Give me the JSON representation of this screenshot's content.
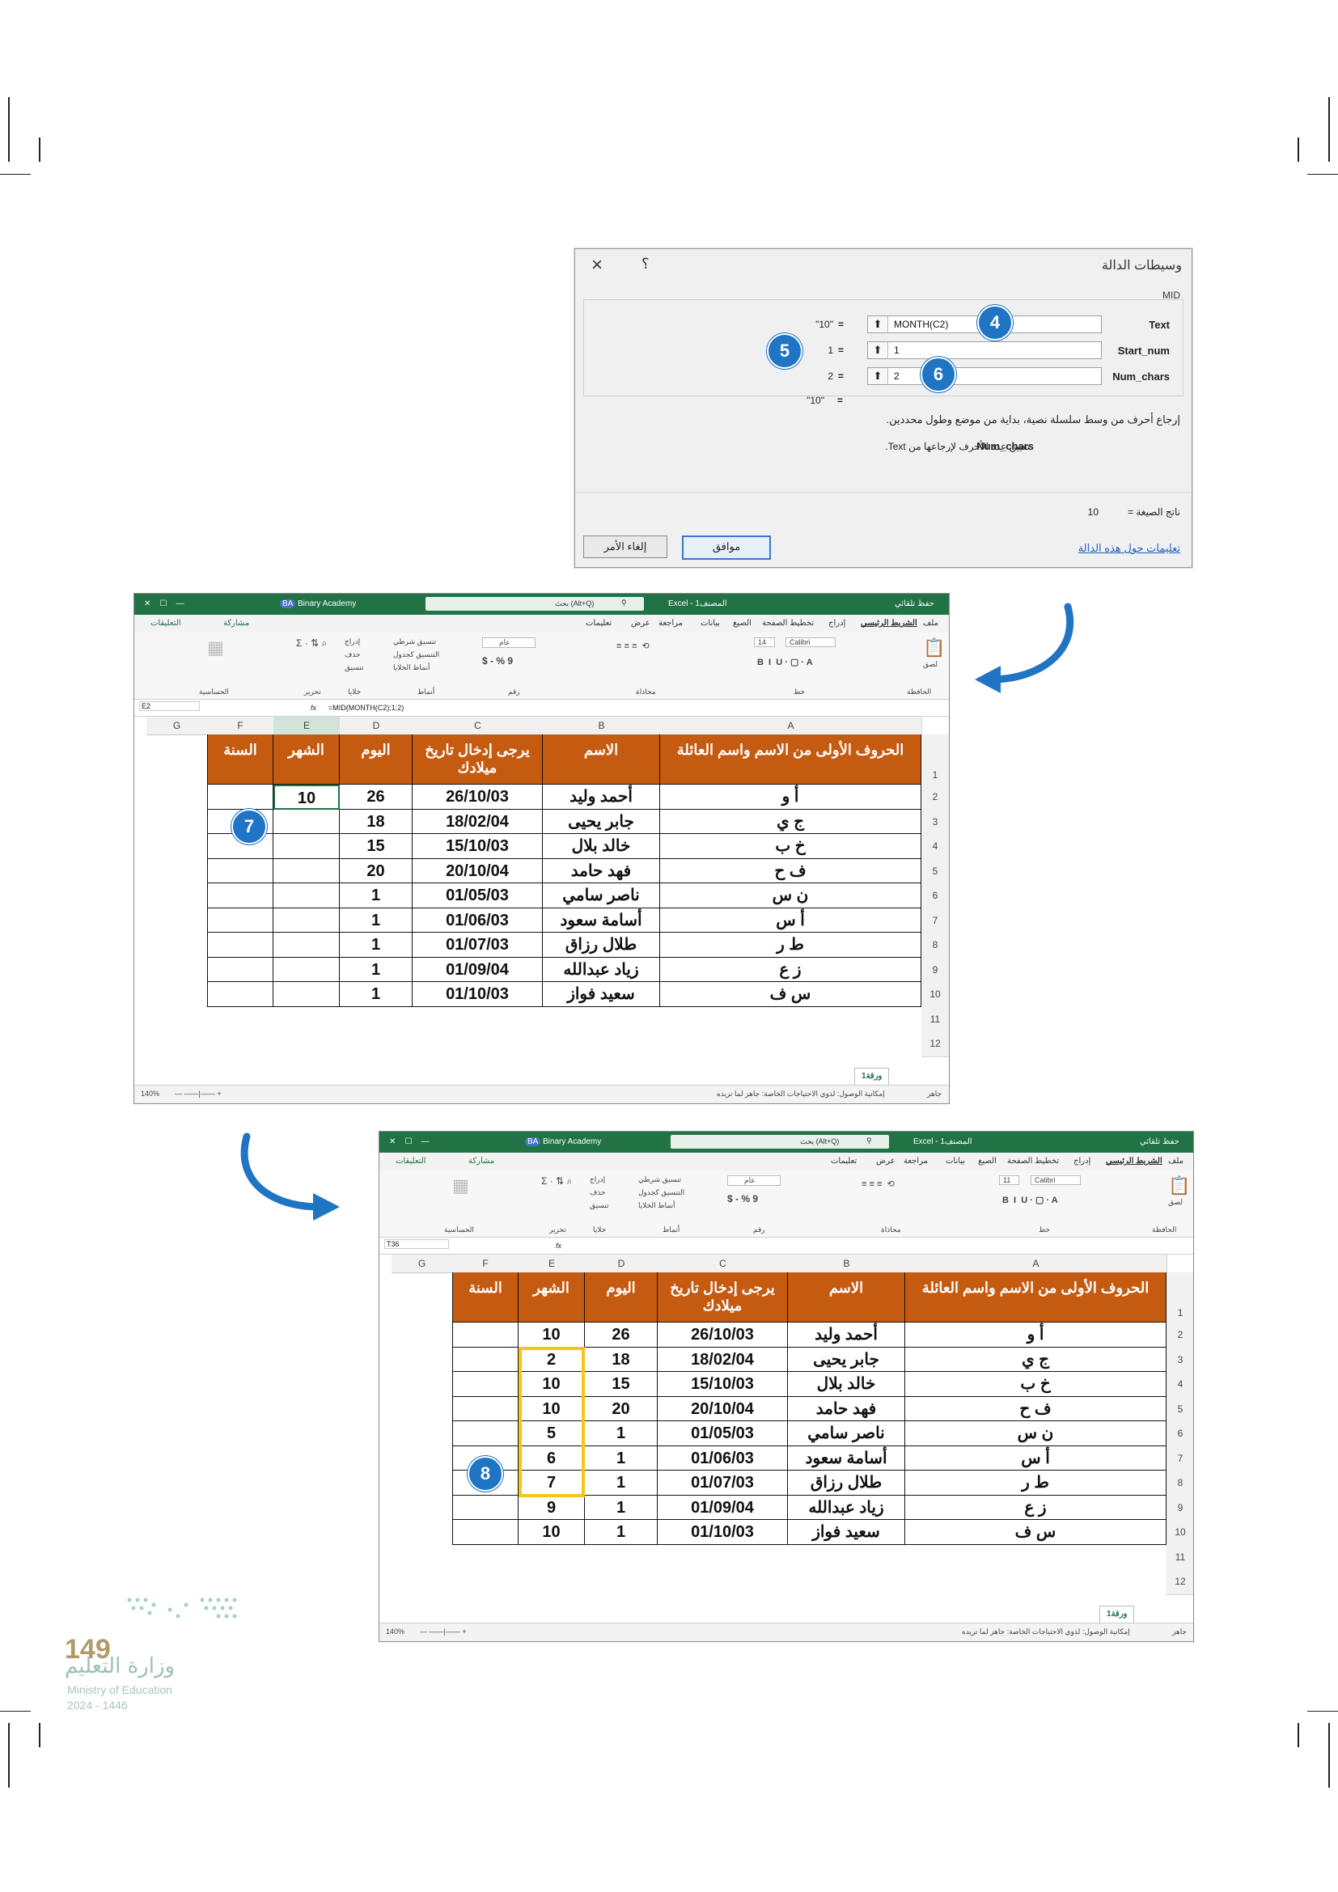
{
  "dialog": {
    "title": "وسيطات الدالة",
    "help": "؟",
    "close": "×",
    "function_name": "MID",
    "args": [
      {
        "label": "Text",
        "value": "MONTH(C2)",
        "result": "\"10\""
      },
      {
        "label": "Start_num",
        "value": "1",
        "result": "1"
      },
      {
        "label": "Num_chars",
        "value": "2",
        "result": "2"
      }
    ],
    "eq": "=",
    "total_result": "\"10\"",
    "description": "إرجاع أحرف من وسط سلسلة نصية، بداية من موضع وطول محددين.",
    "arg_name": "Num_chars",
    "arg_description": "تعيين عدد الأحرف لإرجاعها من Text.",
    "formula_result_label": "ناتج الصيغة =",
    "formula_result_value": "10",
    "help_link": "تعليمات حول هذه الدالة",
    "ok_label": "موافق",
    "cancel_label": "إلغاء الأمر"
  },
  "callouts": {
    "c4": "4",
    "c5": "5",
    "c6": "6",
    "c7": "7",
    "c8": "8"
  },
  "excel": {
    "autosave": "حفظ تلقائي",
    "file_name": "Excel - المصنف1",
    "search": "بحث (Alt+Q)",
    "account": "Binary Academy",
    "account_initials": "BA",
    "tabs": [
      "ملف",
      "الشريط الرئيسي",
      "إدراج",
      "تخطيط الصفحة",
      "الصيغ",
      "بيانات",
      "مراجعة",
      "عرض",
      "تعليمات"
    ],
    "share": "مشاركة",
    "comments": "التعليقات",
    "ribbon": {
      "paste": "لصق",
      "clipboard": "الحافظة",
      "font_name": "Calibri",
      "font_group": "خط",
      "alignment": "محاذاة",
      "number_format": "عام",
      "number": "رقم",
      "cond_format": "تنسيق شرطي",
      "format_table": "التنسيق كجدول",
      "cell_styles": "أنماط الخلايا",
      "styles": "أنماط",
      "insert": "إدراج",
      "delete": "حذف",
      "format": "تنسيق",
      "cells": "خلايا",
      "editing": "تحرير",
      "sensitivity": "الحساسية"
    },
    "fx": "fx",
    "columns_letters": [
      "A",
      "B",
      "C",
      "D",
      "E",
      "F",
      "G"
    ],
    "headers": {
      "A": "الحروف الأولى من الاسم واسم العائلة",
      "B": "الاسم",
      "C": "يرجى إدخال تاريخ ميلادك",
      "D": "اليوم",
      "E": "الشهر",
      "F": "السنة"
    },
    "rows": [
      {
        "A": "أ و",
        "B": "أحمد وليد",
        "C": "26/10/03",
        "D": "26",
        "E": "10"
      },
      {
        "A": "ج ي",
        "B": "جابر يحيى",
        "C": "18/02/04",
        "D": "18",
        "E": "2"
      },
      {
        "A": "خ ب",
        "B": "خالد بلال",
        "C": "15/10/03",
        "D": "15",
        "E": "10"
      },
      {
        "A": "ف ح",
        "B": "فهد حامد",
        "C": "20/10/04",
        "D": "20",
        "E": "10"
      },
      {
        "A": "ن س",
        "B": "ناصر سامي",
        "C": "01/05/03",
        "D": "1",
        "E": "5"
      },
      {
        "A": "أ س",
        "B": "أسامة سعود",
        "C": "01/06/03",
        "D": "1",
        "E": "6"
      },
      {
        "A": "ط ر",
        "B": "طلال رزاق",
        "C": "01/07/03",
        "D": "1",
        "E": "7"
      },
      {
        "A": "ز ع",
        "B": "زياد عبدالله",
        "C": "01/09/04",
        "D": "1",
        "E": "9"
      },
      {
        "A": "س ف",
        "B": "سعيد فواز",
        "C": "01/10/03",
        "D": "1",
        "E": "10"
      }
    ],
    "row_numbers": [
      "1",
      "2",
      "3",
      "4",
      "5",
      "6",
      "7",
      "8",
      "9",
      "10",
      "11",
      "12"
    ],
    "sheet_name": "ورقة1",
    "status_ready": "جاهز",
    "status_access": "إمكانية الوصول: لذوي الاحتياجات الخاصة: جاهز لما تريده",
    "zoom": "140%",
    "win1": {
      "cell_ref": "E2",
      "formula": "=MID(MONTH(C2);1;2)",
      "font_size": "14"
    },
    "win2": {
      "cell_ref": "T36",
      "formula": "",
      "font_size": "11"
    }
  },
  "footer": {
    "page_number": "149",
    "ministry_ar": "وزارة التعليم",
    "ministry_en": "Ministry of Education",
    "year": "2024 - 1446"
  },
  "colors": {
    "header_fill": "#c55a11",
    "excel_green": "#217346",
    "callout": "#1f74c4",
    "highlight": "#f5c518"
  }
}
